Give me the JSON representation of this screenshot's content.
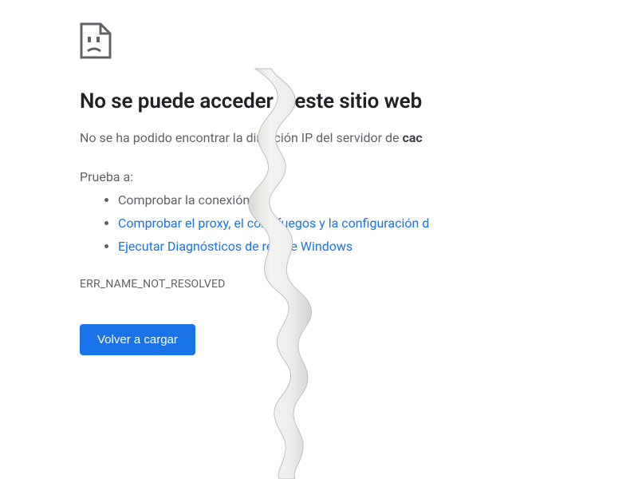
{
  "title": "No se puede acceder a este sitio web",
  "subtitle_prefix": "No se ha podido encontrar la dirección IP del servidor de ",
  "subtitle_bold": "cac",
  "try_label": "Prueba a:",
  "suggestions": [
    {
      "text": "Comprobar la conexión",
      "link": false
    },
    {
      "text": "Comprobar el proxy, el cortafuegos y la configuración d",
      "link": true
    },
    {
      "text": "Ejecutar Diagnósticos de red de Windows",
      "link": true
    }
  ],
  "error_code": "ERR_NAME_NOT_RESOLVED",
  "reload_label": "Volver a cargar"
}
